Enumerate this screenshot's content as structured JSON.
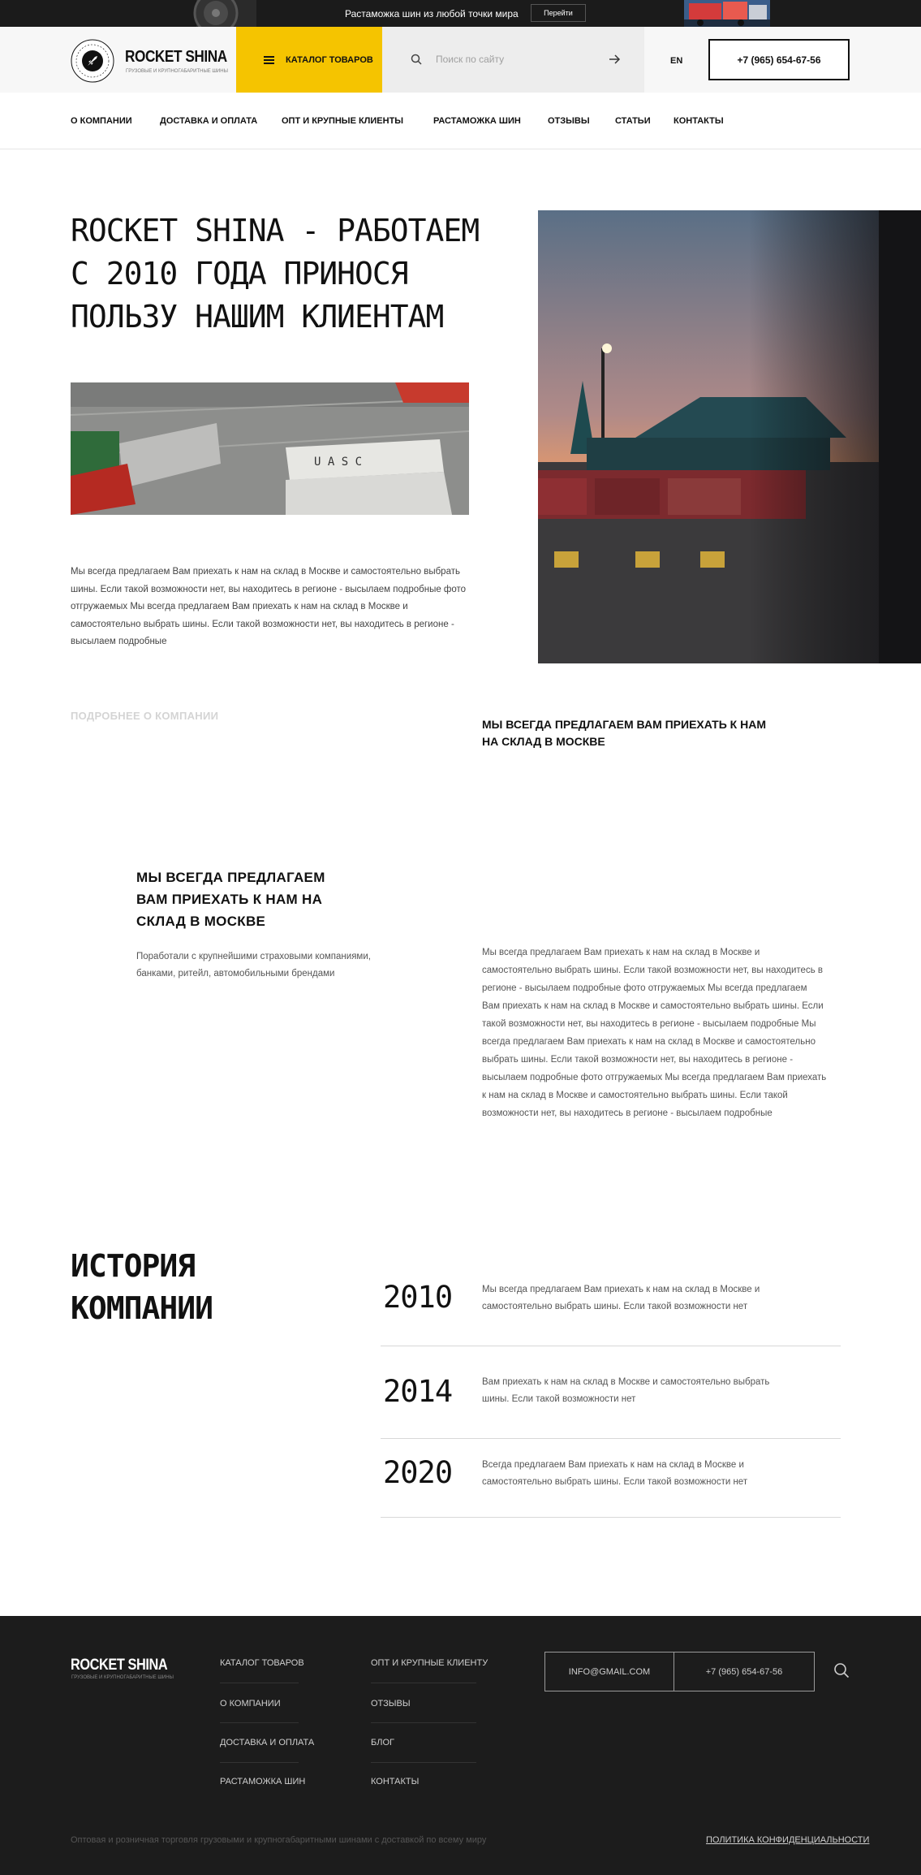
{
  "promo": {
    "text": "Растаможка шин из любой точки мира",
    "button": "Перейти"
  },
  "header": {
    "logo_name": "ROCKET SHINA",
    "logo_sub": "ГРУЗОВЫЕ И КРУПНОГАБАРИТНЫЕ ШИНЫ",
    "catalog_label": "КАТАЛОГ ТОВАРОВ",
    "search_placeholder": "Поиск по сайту",
    "lang": "EN",
    "phone": "+7 (965) 654-67-56"
  },
  "nav": {
    "items": [
      "О КОМПАНИИ",
      "ДОСТАВКА И ОПЛАТА",
      "ОПТ И КРУПНЫЕ КЛИЕНТЫ",
      "РАСТАМОЖКА ШИН",
      "ОТЗЫВЫ",
      "СТАТЬИ",
      "КОНТАКТЫ"
    ]
  },
  "hero": {
    "title": "ROCKET SHINA - РАБОТАЕМ С 2010 ГОДА ПРИНОСЯ ПОЛЬЗУ НАШИМ КЛИЕНТАМ",
    "text": "Мы всегда предлагаем Вам приехать к нам на склад в Москве и самостоятельно выбрать шины. Если такой возможности нет, вы находитесь в регионе - высылаем подробные фото отгружаемых Мы всегда предлагаем Вам приехать к нам на склад в Москве и самостоятельно выбрать шины. Если такой возможности нет, вы находитесь в регионе - высылаем подробные",
    "more": "ПОДРОБНЕЕ О КОМПАНИИ",
    "feature1": "МЫ ВСЕГДА ПРЕДЛАГАЕМ ВАМ ПРИЕХАТЬ К НАМ НА СКЛАД В МОСКВЕ"
  },
  "features": {
    "title": "МЫ ВСЕГДА ПРЕДЛАГАЕМ ВАМ ПРИЕХАТЬ К НАМ НА СКЛАД В МОСКВЕ",
    "subtitle": "Поработали с крупнейшими страховыми компаниями, банками, ритейл, автомобильными брендами",
    "long_text": "Мы всегда предлагаем Вам приехать к нам на склад в Москве и самостоятельно выбрать шины. Если такой возможности нет, вы находитесь в регионе - высылаем подробные фото отгружаемых Мы всегда предлагаем Вам приехать к нам на склад в Москве и самостоятельно выбрать шины. Если такой возможности нет, вы находитесь в регионе - высылаем подробные Мы всегда предлагаем Вам приехать к нам на склад в Москве и самостоятельно выбрать шины. Если такой возможности нет, вы находитесь в регионе - высылаем подробные фото отгружаемых Мы всегда предлагаем Вам приехать к нам на склад в Москве и самостоятельно выбрать шины. Если такой возможности нет, вы находитесь в регионе - высылаем подробные"
  },
  "history": {
    "title": "ИСТОРИЯ КОМПАНИИ",
    "items": [
      {
        "year": "2010",
        "text": "Мы всегда предлагаем Вам приехать к нам на склад в Москве и самостоятельно выбрать шины. Если такой возможности нет"
      },
      {
        "year": "2014",
        "text": "Вам приехать к нам на склад в Москве и самостоятельно выбрать шины. Если такой возможности нет"
      },
      {
        "year": "2020",
        "text": "Всегда предлагаем Вам приехать к нам на склад в Москве и самостоятельно выбрать шины. Если такой возможности нет"
      }
    ]
  },
  "footer": {
    "logo_name": "ROCKET SHINA",
    "logo_sub": "ГРУЗОВЫЕ И КРУПНОГАБАРИТНЫЕ ШИНЫ",
    "col1": [
      "КАТАЛОГ ТОВАРОВ",
      "О КОМПАНИИ",
      "ДОСТАВКА И ОПЛАТА",
      "РАСТАМОЖКА ШИН"
    ],
    "col2": [
      "ОПТ И КРУПНЫЕ КЛИЕНТУ",
      "ОТЗЫВЫ",
      "БЛОГ",
      "КОНТАКТЫ"
    ],
    "email": "INFO@GMAIL.COM",
    "phone": "+7 (965) 654-67-56",
    "copyright": "Оптовая и розничная торговля грузовыми и крупногабаритными шинами с доставкой по всему миру",
    "policy": "ПОЛИТИКА КОНФИДЕНЦИАЛЬНОСТИ"
  },
  "colors": {
    "accent": "#f5c400",
    "dark": "#1c1c1c",
    "promo_bg": "#1b1b1b"
  }
}
